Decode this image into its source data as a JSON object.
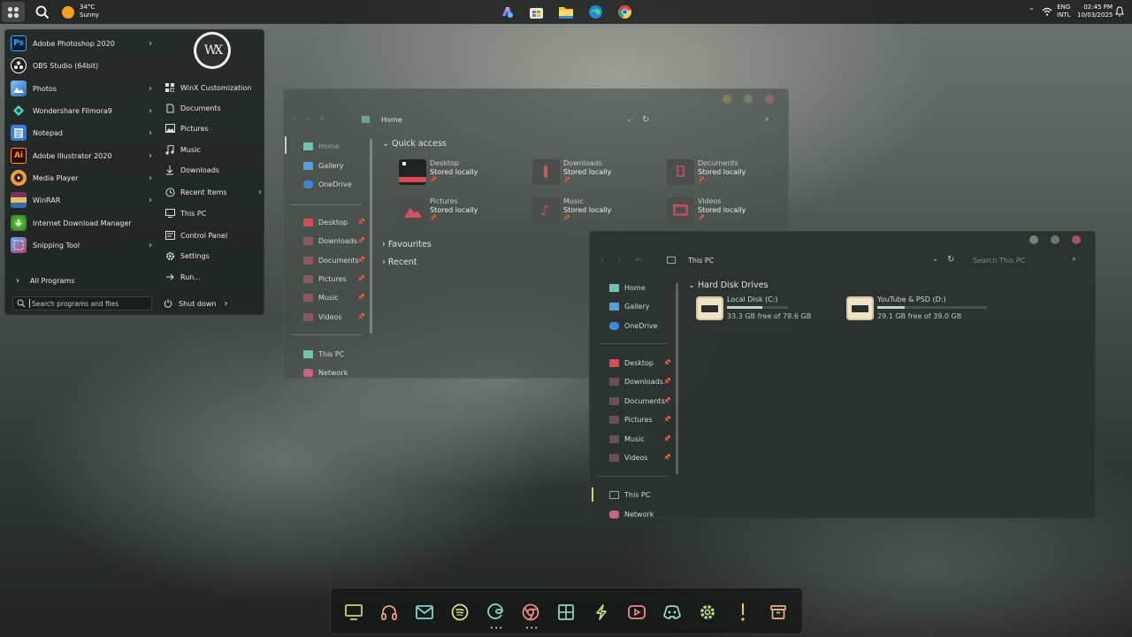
{
  "topbar": {
    "weather": {
      "temp": "34°C",
      "condition": "Sunny"
    },
    "language": {
      "code": "ENG",
      "layout": "INTL"
    },
    "clock": {
      "time": "02:45 PM",
      "date": "10/03/2025"
    }
  },
  "start_menu": {
    "logo": "WX",
    "programs": [
      {
        "label": "Adobe Photoshop 2020",
        "icon": "Ps",
        "color": "#001e36",
        "accent": "#31a8ff",
        "has_arrow": true
      },
      {
        "label": "OBS Studio (64bit)",
        "icon": "obs",
        "color": "#202020",
        "accent": "#ffffff",
        "has_arrow": false
      },
      {
        "label": "Photos",
        "icon": "photos",
        "color": "#2e6fb6",
        "accent": "#7dc4ff",
        "has_arrow": true
      },
      {
        "label": "Wondershare Filmora9",
        "icon": "filmora",
        "color": "#1f4b4b",
        "accent": "#3ee8c8",
        "has_arrow": true
      },
      {
        "label": "Notepad",
        "icon": "notepad",
        "color": "#3a7bd5",
        "accent": "#a7cdf6",
        "has_arrow": true
      },
      {
        "label": "Adobe Illustrator 2020",
        "icon": "Ai",
        "color": "#330000",
        "accent": "#ff9a00",
        "has_arrow": true
      },
      {
        "label": "Media Player",
        "icon": "media",
        "color": "#3b2a1c",
        "accent": "#f39a3c",
        "has_arrow": true
      },
      {
        "label": "WinRAR",
        "icon": "winrar",
        "color": "#7a2f63",
        "accent": "#e6c35a",
        "has_arrow": true
      },
      {
        "label": "Internet Download Manager",
        "icon": "idm",
        "color": "#2a6a1e",
        "accent": "#6fdc4a",
        "has_arrow": false
      },
      {
        "label": "Snipping Tool",
        "icon": "snip",
        "color": "#c33b5c",
        "accent": "#5ab0ff",
        "has_arrow": true
      }
    ],
    "all_programs": "All Programs",
    "right_items": [
      {
        "label": "WinX Customization",
        "icon": "customize-icon"
      },
      {
        "label": "Documents",
        "icon": "document-icon"
      },
      {
        "label": "Pictures",
        "icon": "picture-icon"
      },
      {
        "label": "Music",
        "icon": "music-icon"
      },
      {
        "label": "Downloads",
        "icon": "download-icon"
      },
      {
        "label": "Recent Items",
        "icon": "recent-icon"
      },
      {
        "label": "This PC",
        "icon": "pc-icon"
      },
      {
        "label": "Control Panel",
        "icon": "control-panel-icon"
      },
      {
        "label": "Settings",
        "icon": "gear-icon"
      },
      {
        "label": "Run...",
        "icon": "run-icon"
      }
    ],
    "search_placeholder": "Search programs and files",
    "shutdown": "Shut down"
  },
  "explorer_home": {
    "breadcrumb": "Home",
    "nav_top": [
      "Home",
      "Gallery",
      "OneDrive"
    ],
    "nav_pinned": [
      "Desktop",
      "Downloads",
      "Documents",
      "Pictures",
      "Music",
      "Videos"
    ],
    "nav_bottom": [
      "This PC",
      "Network"
    ],
    "section": "Quick access",
    "tiles": [
      {
        "name": "Desktop",
        "status": "Stored locally",
        "color": "#d9494f"
      },
      {
        "name": "Downloads",
        "status": "Stored locally",
        "color": "#c35b66"
      },
      {
        "name": "Documents",
        "status": "Stored locally",
        "color": "#b54d5c"
      },
      {
        "name": "Pictures",
        "status": "Stored locally",
        "color": "#d35461"
      },
      {
        "name": "Music",
        "status": "Stored locally",
        "color": "#d34b58"
      },
      {
        "name": "Videos",
        "status": "Stored locally",
        "color": "#c44756"
      }
    ],
    "collapsed": [
      "Favourites",
      "Recent"
    ]
  },
  "explorer_pc": {
    "breadcrumb": "This PC",
    "search_placeholder": "Search This PC",
    "nav_top": [
      "Home",
      "Gallery",
      "OneDrive"
    ],
    "nav_pinned": [
      "Desktop",
      "Downloads",
      "Documents",
      "Pictures",
      "Music",
      "Videos"
    ],
    "nav_bottom": [
      "This PC",
      "Network"
    ],
    "section": "Hard Disk Drives",
    "drives": [
      {
        "name": "Local Disk (C:)",
        "free": "33.3 GB free of 78.6 GB",
        "used_fraction": 0.58
      },
      {
        "name": "YouTube & PSD (D:)",
        "free": "29.1 GB free of 39.0 GB",
        "used_fraction": 0.25
      }
    ]
  },
  "dock": {
    "items": [
      {
        "name": "monitor-icon",
        "color": "#c5d86a"
      },
      {
        "name": "headphones-icon",
        "color": "#f0a070"
      },
      {
        "name": "mail-icon",
        "color": "#7fd6d0"
      },
      {
        "name": "spotify-icon",
        "color": "#d7e07a"
      },
      {
        "name": "edge-icon",
        "color": "#7fd6c8"
      },
      {
        "name": "chrome-icon",
        "color": "#f08a8a"
      },
      {
        "name": "windows-icon",
        "color": "#8ad6c8"
      },
      {
        "name": "bolt-icon",
        "color": "#c5e07a"
      },
      {
        "name": "youtube-icon",
        "color": "#f08a8a"
      },
      {
        "name": "discord-icon",
        "color": "#9fe0c0"
      },
      {
        "name": "gear-icon",
        "color": "#b8e08a"
      },
      {
        "name": "more-icon",
        "color": "#f0c070"
      },
      {
        "name": "archive-icon",
        "color": "#f0b080"
      }
    ]
  }
}
